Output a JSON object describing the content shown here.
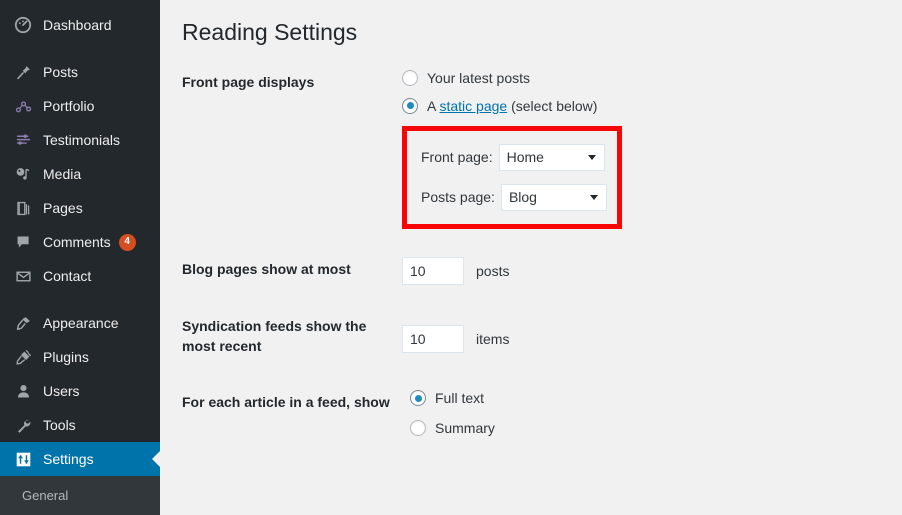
{
  "sidebar": {
    "items": [
      {
        "label": "Dashboard",
        "icon": "dashboard-icon",
        "active": false,
        "badge": null
      },
      {
        "label": "Posts",
        "icon": "pin-icon",
        "active": false,
        "badge": null
      },
      {
        "label": "Portfolio",
        "icon": "portfolio-icon",
        "active": false,
        "badge": null
      },
      {
        "label": "Testimonials",
        "icon": "testimonials-icon",
        "active": false,
        "badge": null
      },
      {
        "label": "Media",
        "icon": "media-icon",
        "active": false,
        "badge": null
      },
      {
        "label": "Pages",
        "icon": "pages-icon",
        "active": false,
        "badge": null
      },
      {
        "label": "Comments",
        "icon": "comment-icon",
        "active": false,
        "badge": "4"
      },
      {
        "label": "Contact",
        "icon": "envelope-icon",
        "active": false,
        "badge": null
      },
      {
        "label": "Appearance",
        "icon": "brush-icon",
        "active": false,
        "badge": null
      },
      {
        "label": "Plugins",
        "icon": "plug-icon",
        "active": false,
        "badge": null
      },
      {
        "label": "Users",
        "icon": "user-icon",
        "active": false,
        "badge": null
      },
      {
        "label": "Tools",
        "icon": "wrench-icon",
        "active": false,
        "badge": null
      },
      {
        "label": "Settings",
        "icon": "settings-icon",
        "active": true,
        "badge": null
      }
    ],
    "submenu": [
      {
        "label": "General"
      }
    ],
    "colors": {
      "background": "#23282d",
      "active_background": "#0073aa",
      "submenu_background": "#32373c",
      "badge_background": "#d54e21"
    }
  },
  "main": {
    "title": "Reading Settings",
    "rows": {
      "front_page_displays": {
        "label": "Front page displays",
        "option_latest": "Your latest posts",
        "option_static_prefix": "A ",
        "option_static_link": "static page",
        "option_static_suffix": " (select below)",
        "latest_checked": false,
        "static_checked": true
      },
      "static_page_box": {
        "highlight_color": "#fa0505",
        "front_page_label": "Front page:",
        "front_page_value": "Home",
        "posts_page_label": "Posts page:",
        "posts_page_value": "Blog"
      },
      "blog_pages": {
        "label": "Blog pages show at most",
        "value": "10",
        "unit": "posts"
      },
      "syndication_feeds": {
        "label": "Syndication feeds show the most recent",
        "value": "10",
        "unit": "items"
      },
      "feed_article": {
        "label": "For each article in a feed, show",
        "option_full": "Full text",
        "option_summary": "Summary",
        "full_checked": true,
        "summary_checked": false
      }
    }
  }
}
